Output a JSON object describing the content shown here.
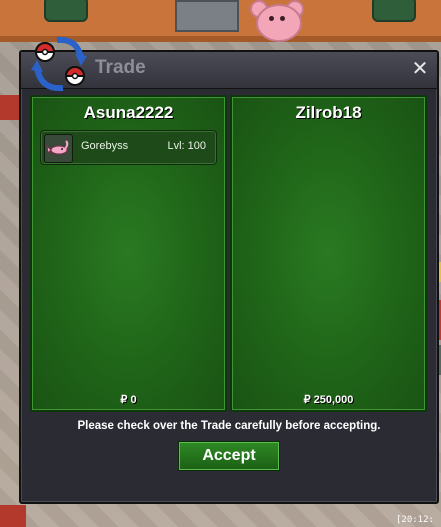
{
  "window": {
    "title": "Trade",
    "close_label": "✕"
  },
  "left_panel": {
    "trader": "Asuna2222",
    "items": [
      {
        "name": "Gorebyss",
        "level": "Lvl: 100"
      }
    ],
    "money": "₽ 0"
  },
  "right_panel": {
    "trader": "Zilrob18",
    "money": "₽ 250,000"
  },
  "notice": "Please check over the Trade carefully before accepting.",
  "accept_label": "Accept",
  "hud": {
    "timestamp": "[20:12:"
  },
  "colors": {
    "panel_green": "#1f6418",
    "window_bg": "#2b2b34",
    "accept_green": "#2f8a25"
  },
  "icons": {
    "logo": "trade-pokeball-arrows-icon",
    "close": "close-icon",
    "item": "gorebyss-sprite-icon"
  }
}
